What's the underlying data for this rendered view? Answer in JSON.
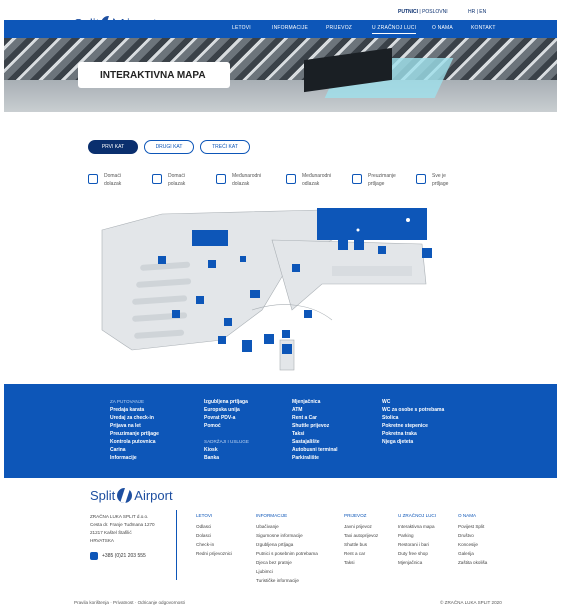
{
  "utility": {
    "links_bold": "PUTNICI",
    "links_rest": " | POSLOVNI",
    "lang": "HR | EN"
  },
  "logo": {
    "left": "Split",
    "right": "Airport"
  },
  "nav": [
    "LETOVI",
    "INFORMACIJE",
    "PRIJEVOZ",
    "U ZRAČNOJ LUCI",
    "O NAMA",
    "KONTAKT"
  ],
  "hero": {
    "title": "INTERAKTIVNA MAPA"
  },
  "tabs": [
    "PRVI KAT",
    "DRUGI KAT",
    "TREĆI KAT"
  ],
  "filters": [
    [
      "Domaći",
      "dolazak"
    ],
    [
      "Domaći",
      "polazak"
    ],
    [
      "Međunarodni",
      "dolazak"
    ],
    [
      "Međunarodni",
      "odlazak"
    ],
    [
      "Preuzimanje",
      "prtljage"
    ],
    [
      "Sve je",
      "prtljage"
    ]
  ],
  "footer": {
    "col1_head": "ZA PUTOVANJE",
    "col1": [
      "Predaja karata",
      "Uredaj za check-in",
      "Prijava na let",
      "Preuzimanje prtljage",
      "Kontrola putovnica",
      "Carina",
      "Informacije"
    ],
    "col2": [
      "Izgubljena prtljaga",
      "Europska unija",
      "Povrat PDV-a",
      "Pomoć"
    ],
    "col2_head2": "SADRŽAJI I USLUGE",
    "col2b": [
      "Kiosk",
      "Banka"
    ],
    "col3": [
      "Mjenjačnica",
      "ATM",
      "Rent a Car",
      "Shuttle prijevoz",
      "Taksi",
      "Sastajalište",
      "Autobusni terminal",
      "Parkiralište"
    ],
    "col4": [
      "WC",
      "WC za osobe s potrebama",
      "Stolica",
      "Pokretne stepenice",
      "Pokretna traka",
      "Njega djeteta"
    ]
  },
  "contact": {
    "address": [
      "ZRAČNA LUKA SPLIT d.o.o.",
      "Cesta dr. Franje Tuđmana 1270",
      "21217 Kaštel Štafilić",
      "HRVATSKA"
    ],
    "phone": "+385 (0)21 203 555"
  },
  "footer_links": [
    {
      "head": "LETOVI",
      "items": [
        "Odlasci",
        "Dolasci",
        "Check-in",
        "Redni prijevoznici"
      ]
    },
    {
      "head": "INFORMACIJE",
      "items": [
        "Ubačivanje",
        "Sigurnosne informacije",
        "Izgubljena prtljaga",
        "Putnici s posebnim potrebama",
        "Djeca bez pratnje",
        "Ljubimci",
        "Turističke informacije"
      ]
    },
    {
      "head": "PRIJEVOZ",
      "items": [
        "Javni prijevoz",
        "Taxi autoprijevoz",
        "Shuttle bus",
        "Rent a car",
        "Taksi"
      ]
    },
    {
      "head": "U ZRAČNOJ LUCI",
      "items": [
        "Interaktivna mapa",
        "Parking",
        "Restorani i bari",
        "Duty free shop",
        "Mjenjačnica"
      ]
    },
    {
      "head": "O NAMA",
      "items": [
        "Povijest Split",
        "Društvo",
        "Koncesije",
        "Galerija",
        "Zaštita okoliša"
      ]
    }
  ],
  "bottom": {
    "left": "Pravila korištenja · Privatnost · Odricanje odgovornosti",
    "right": "© ZRAČNA LUKA SPLIT 2020"
  },
  "colors": {
    "primary": "#0d56b8",
    "dark": "#0a2f6e"
  }
}
